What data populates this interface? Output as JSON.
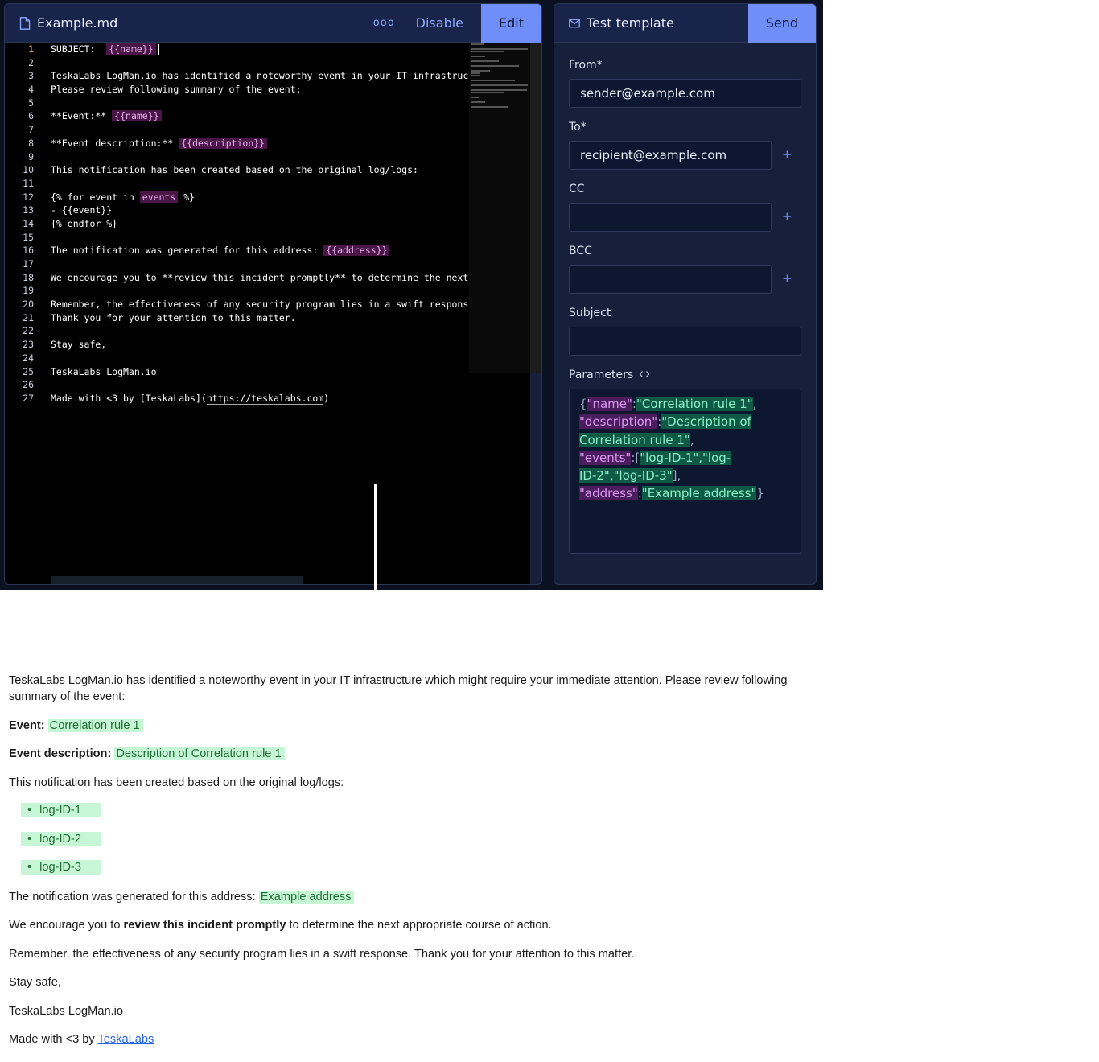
{
  "editor": {
    "file_name": "Example.md",
    "more_label": "ooo",
    "disable_label": "Disable",
    "edit_label": "Edit",
    "line_numbers": [
      "1",
      "2",
      "3",
      "4",
      "5",
      "6",
      "7",
      "8",
      "9",
      "10",
      "11",
      "12",
      "13",
      "14",
      "15",
      "16",
      "17",
      "18",
      "19",
      "20",
      "21",
      "22",
      "23",
      "24",
      "25",
      "26",
      "27"
    ],
    "lines": [
      {
        "parts": [
          {
            "t": "SUBJECT:  "
          },
          {
            "t": "{{name}}",
            "tok": true
          }
        ]
      },
      {
        "parts": []
      },
      {
        "parts": [
          {
            "t": "TeskaLabs LogMan.io has identified a noteworthy event in your IT infrastructur"
          }
        ]
      },
      {
        "parts": [
          {
            "t": "Please review following summary of the event:"
          }
        ]
      },
      {
        "parts": []
      },
      {
        "parts": [
          {
            "t": "**Event:** "
          },
          {
            "t": "{{name}}",
            "tok": true
          }
        ]
      },
      {
        "parts": []
      },
      {
        "parts": [
          {
            "t": "**Event description:** "
          },
          {
            "t": "{{description}}",
            "tok": true
          }
        ]
      },
      {
        "parts": []
      },
      {
        "parts": [
          {
            "t": "This notification has been created based on the original log/logs:"
          }
        ]
      },
      {
        "parts": []
      },
      {
        "parts": [
          {
            "t": "{% for event in "
          },
          {
            "t": "events",
            "tok": true
          },
          {
            "t": " %}"
          }
        ]
      },
      {
        "parts": [
          {
            "t": "- {{event}}"
          }
        ]
      },
      {
        "parts": [
          {
            "t": "{% endfor %}"
          }
        ]
      },
      {
        "parts": []
      },
      {
        "parts": [
          {
            "t": "The notification was generated for this address: "
          },
          {
            "t": "{{address}}",
            "tok": true
          }
        ]
      },
      {
        "parts": []
      },
      {
        "parts": [
          {
            "t": "We encourage you to **review this incident promptly** to determine the next ap"
          }
        ]
      },
      {
        "parts": []
      },
      {
        "parts": [
          {
            "t": "Remember, the effectiveness of any security program lies in a swift response."
          }
        ]
      },
      {
        "parts": [
          {
            "t": "Thank you for your attention to this matter."
          }
        ]
      },
      {
        "parts": []
      },
      {
        "parts": [
          {
            "t": "Stay safe,"
          }
        ]
      },
      {
        "parts": []
      },
      {
        "parts": [
          {
            "t": "TeskaLabs LogMan.io"
          }
        ]
      },
      {
        "parts": []
      },
      {
        "parts": [
          {
            "t": "Made with <3 by [TeskaLabs]("
          },
          {
            "t": "https://teskalabs.com",
            "url": true
          },
          {
            "t": ")"
          }
        ]
      }
    ]
  },
  "test": {
    "title": "Test template",
    "send_label": "Send",
    "from_label": "From*",
    "from_value": "sender@example.com",
    "to_label": "To*",
    "to_value": "recipient@example.com",
    "cc_label": "CC",
    "cc_value": "",
    "bcc_label": "BCC",
    "bcc_value": "",
    "subject_label": "Subject",
    "subject_value": "",
    "parameters_label": "Parameters",
    "plus_label": "+",
    "params_lines": [
      [
        {
          "t": "{",
          "c": ""
        },
        {
          "t": "\"name\"",
          "c": "pk"
        },
        {
          "t": ":",
          "c": ""
        },
        {
          "t": "\"Correlation rule 1\"",
          "c": "pv"
        },
        {
          "t": ",",
          "c": ""
        }
      ],
      [
        {
          "t": "\"description\"",
          "c": "pk"
        },
        {
          "t": ":",
          "c": ""
        },
        {
          "t": "\"Description of",
          "c": "pv"
        }
      ],
      [
        {
          "t": "Correlation rule 1\"",
          "c": "pv"
        },
        {
          "t": ",",
          "c": ""
        }
      ],
      [
        {
          "t": "\"events\"",
          "c": "pk"
        },
        {
          "t": ":[",
          "c": ""
        },
        {
          "t": "\"log-ID-1\",\"log-",
          "c": "pv"
        }
      ],
      [
        {
          "t": "ID-2\",\"log-ID-3\"",
          "c": "pv"
        },
        {
          "t": "],",
          "c": ""
        }
      ],
      [
        {
          "t": "\"address\"",
          "c": "pk"
        },
        {
          "t": ":",
          "c": ""
        },
        {
          "t": "\"Example address\"",
          "c": "pv"
        },
        {
          "t": "}",
          "c": ""
        }
      ]
    ]
  },
  "preview": {
    "intro": "TeskaLabs LogMan.io has identified a noteworthy event in your IT infrastructure which might require your immediate attention. Please review following summary of the event:",
    "event_label": "Event:",
    "event_value": "Correlation rule 1",
    "desc_label": "Event description:",
    "desc_value": "Description of Correlation rule 1",
    "based_text": "This notification has been created based on the original log/logs:",
    "events": [
      "log-ID-1",
      "log-ID-2",
      "log-ID-3"
    ],
    "address_text": "The notification was generated for this address:",
    "address_value": "Example address",
    "encourage_pre": "We encourage you to",
    "encourage_bold": "review this incident promptly",
    "encourage_post": "to determine the next appropriate course of action.",
    "remember_text": "Remember, the effectiveness of any security program lies in a swift response. Thank you for your attention to this matter.",
    "stay_safe": "Stay safe,",
    "signature": "TeskaLabs LogMan.io",
    "made_with_pre": "Made with <3 by",
    "made_with_link": "TeskaLabs"
  }
}
